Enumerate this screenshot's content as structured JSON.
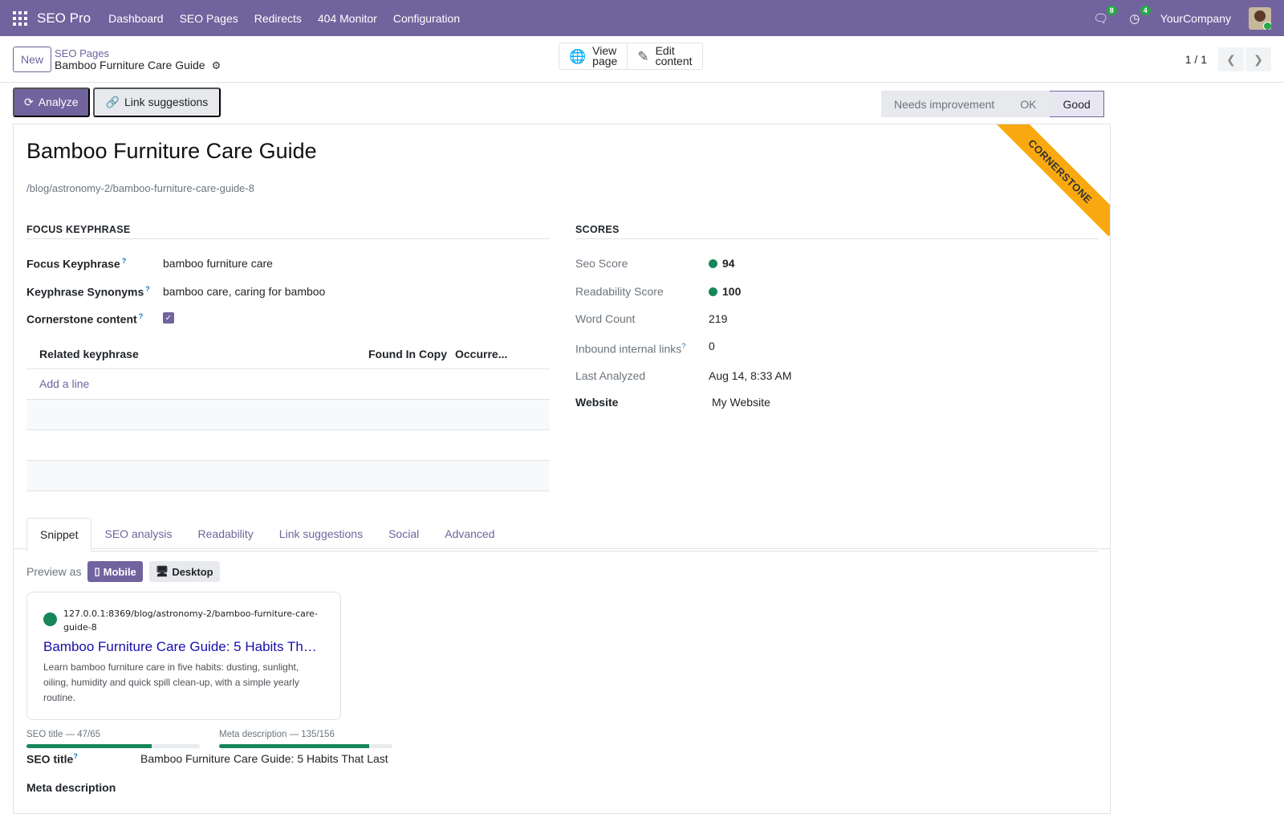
{
  "navbar": {
    "app_name": "SEO Pro",
    "menu": [
      "Dashboard",
      "SEO Pages",
      "Redirects",
      "404 Monitor",
      "Configuration"
    ],
    "messages_count": "8",
    "activities_count": "4",
    "company": "YourCompany"
  },
  "control": {
    "new_label": "New",
    "breadcrumb_parent": "SEO Pages",
    "breadcrumb_current": "Bamboo Furniture Care Guide",
    "view_page_line1": "View",
    "view_page_line2": "page",
    "edit_content_line1": "Edit",
    "edit_content_line2": "content",
    "pager": "1 / 1"
  },
  "actions": {
    "analyze": "Analyze",
    "link_suggestions": "Link suggestions"
  },
  "statusbar": {
    "stages": [
      "Needs improvement",
      "OK",
      "Good"
    ],
    "active": "Good"
  },
  "record": {
    "ribbon": "CORNERSTONE",
    "title": "Bamboo Furniture Care Guide",
    "url": "/blog/astronomy-2/bamboo-furniture-care-guide-8",
    "focus_group": "FOCUS KEYPHRASE",
    "focus_keyphrase_label": "Focus Keyphrase",
    "focus_keyphrase": "bamboo furniture care",
    "synonyms_label": "Keyphrase Synonyms",
    "synonyms": "bamboo care, caring for bamboo",
    "cornerstone_label": "Cornerstone content",
    "cornerstone": true,
    "related_cols": [
      "Related keyphrase",
      "Found In Copy",
      "Occurre..."
    ],
    "add_line": "Add a line",
    "scores_group": "SCORES",
    "seo_score_label": "Seo Score",
    "seo_score": "94",
    "readability_label": "Readability Score",
    "readability": "100",
    "word_count_label": "Word Count",
    "word_count": "219",
    "inbound_label": "Inbound internal links",
    "inbound": "0",
    "last_analyzed_label": "Last Analyzed",
    "last_analyzed": "Aug 14, 8:33 AM",
    "website_label": "Website",
    "website": "My Website"
  },
  "tabs": [
    "Snippet",
    "SEO analysis",
    "Readability",
    "Link suggestions",
    "Social",
    "Advanced"
  ],
  "snippet": {
    "preview_as": "Preview as",
    "mobile": "Mobile",
    "desktop": "Desktop",
    "url": "127.0.0.1:8369/blog/astronomy-2/bamboo-furniture-care-guide-8",
    "title": "Bamboo Furniture Care Guide: 5 Habits That Last",
    "description": "Learn bamboo furniture care in five habits: dusting, sunlight, oiling, humidity and quick spill clean-up, with a simple yearly routine.",
    "seo_title_meter": "SEO title — 47/65",
    "seo_title_fraction": 0.723,
    "meta_desc_meter": "Meta description — 135/156",
    "meta_desc_fraction": 0.865,
    "seo_title_label": "SEO title",
    "seo_title_value": "Bamboo Furniture Care Guide: 5 Habits That Last",
    "meta_desc_label": "Meta description"
  },
  "colors": {
    "brand": "#71639e",
    "score_good": "#17875a",
    "ribbon": "#f9a90f"
  }
}
